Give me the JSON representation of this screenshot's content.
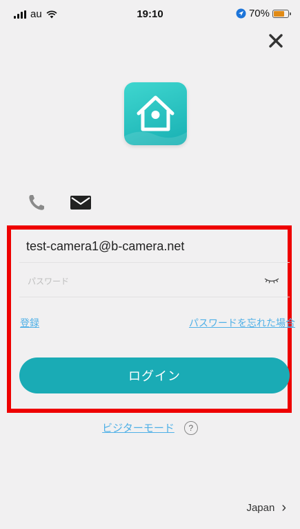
{
  "status_bar": {
    "carrier": "au",
    "time": "19:10",
    "battery_percent": "70%",
    "battery_level": 0.7
  },
  "login": {
    "email_value": "test-camera1@b-camera.net",
    "password_placeholder": "パスワード",
    "register_label": "登録",
    "forgot_password_label": "パスワードを忘れた場合",
    "login_button_label": "ログイン",
    "visitor_mode_label": "ビジターモード",
    "help_symbol": "?"
  },
  "region": {
    "label": "Japan",
    "chevron": "›"
  },
  "icons": {
    "close": "close-icon",
    "phone": "phone-icon",
    "mail": "mail-icon",
    "eye": "eye-closed-icon",
    "app": "house-camera-icon"
  },
  "colors": {
    "accent": "#1aabb5",
    "link": "#4fb0e7",
    "highlight": "#ee0000",
    "background": "#f1f0f1"
  }
}
